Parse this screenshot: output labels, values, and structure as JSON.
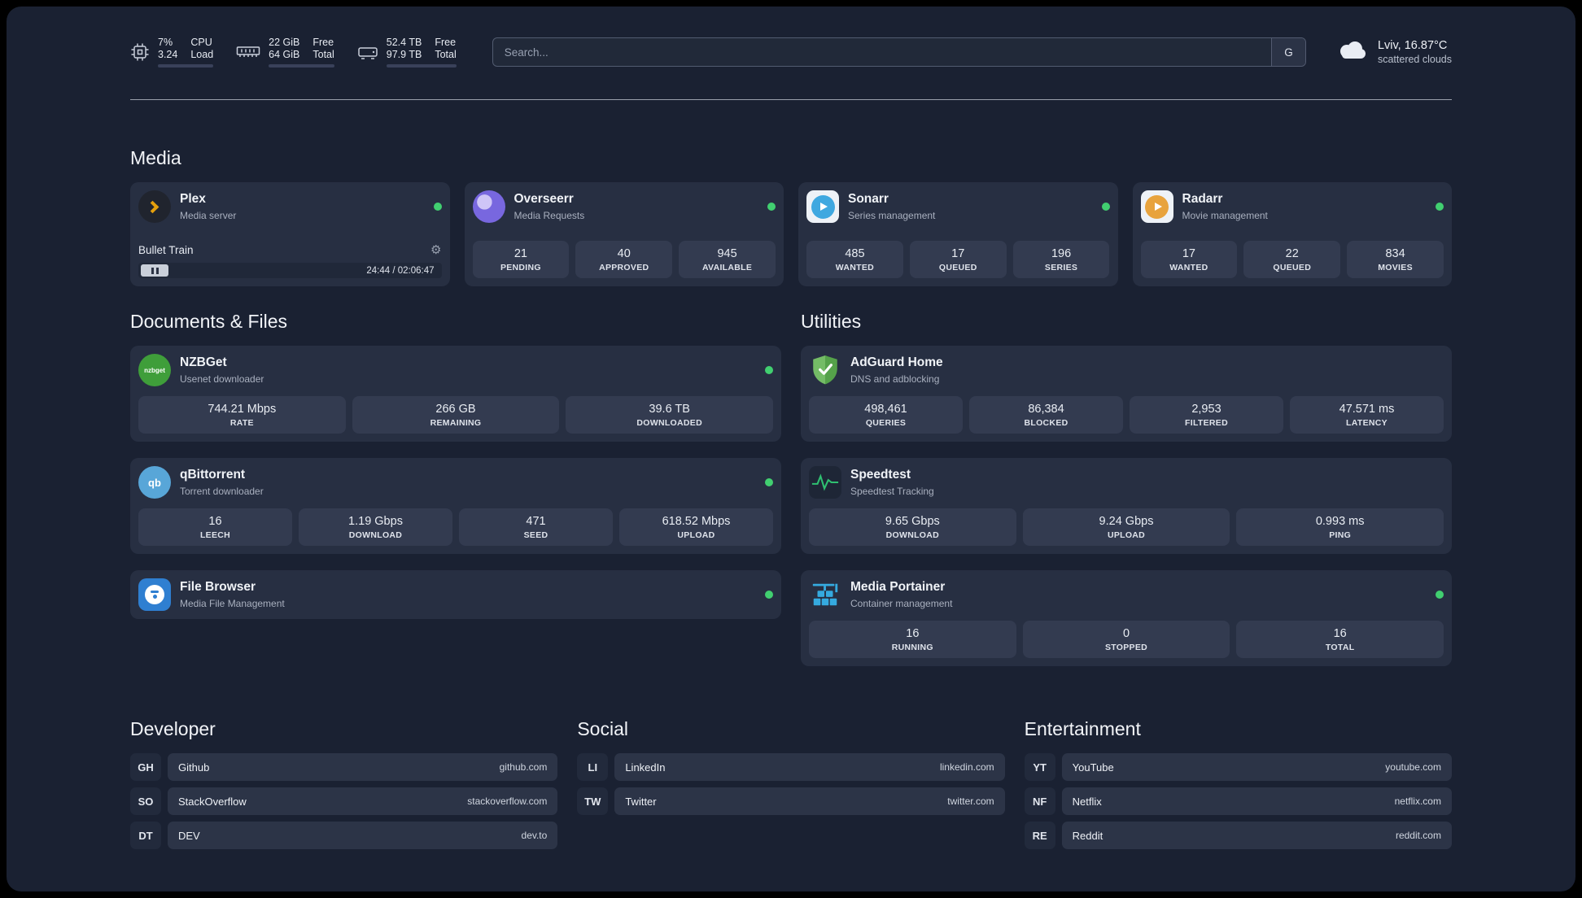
{
  "colors": {
    "background": "#1a2132",
    "card": "#272f42",
    "tile": "#333b50",
    "status_green": "#41cf70",
    "plex_amber": "#e5a00d",
    "overseerr_purple": "#7867df",
    "sonarr_blue": "#3fa8e0",
    "radarr_gold": "#e8a33d",
    "nzbget_green": "#3f9e3a",
    "qbittorrent_blue": "#58a6d8",
    "filebrowser_blue": "#2f7fd1",
    "adguard_green": "#67b279",
    "speedtest_green": "#2fbf71",
    "portainer_blue": "#35aadf"
  },
  "topbar": {
    "cpu": {
      "value1": "7%",
      "value2": "3.24",
      "label1": "CPU",
      "label2": "Load"
    },
    "memory": {
      "value1": "22 GiB",
      "value2": "64 GiB",
      "label1": "Free",
      "label2": "Total"
    },
    "disk": {
      "value1": "52.4 TB",
      "value2": "97.9 TB",
      "label1": "Free",
      "label2": "Total"
    },
    "search": {
      "placeholder": "Search...",
      "engine": "G"
    },
    "weather": {
      "location": "Lviv, 16.87°C",
      "condition": "scattered clouds"
    }
  },
  "media": {
    "title": "Media",
    "plex": {
      "name": "Plex",
      "subtitle": "Media server",
      "track": "Bullet Train",
      "time": "24:44 / 02:06:47"
    },
    "overseerr": {
      "name": "Overseerr",
      "subtitle": "Media Requests",
      "stats": [
        {
          "value": "21",
          "label": "PENDING"
        },
        {
          "value": "40",
          "label": "APPROVED"
        },
        {
          "value": "945",
          "label": "AVAILABLE"
        }
      ]
    },
    "sonarr": {
      "name": "Sonarr",
      "subtitle": "Series management",
      "stats": [
        {
          "value": "485",
          "label": "WANTED"
        },
        {
          "value": "17",
          "label": "QUEUED"
        },
        {
          "value": "196",
          "label": "SERIES"
        }
      ]
    },
    "radarr": {
      "name": "Radarr",
      "subtitle": "Movie management",
      "stats": [
        {
          "value": "17",
          "label": "WANTED"
        },
        {
          "value": "22",
          "label": "QUEUED"
        },
        {
          "value": "834",
          "label": "MOVIES"
        }
      ]
    }
  },
  "documents": {
    "title": "Documents & Files",
    "nzbget": {
      "name": "NZBGet",
      "subtitle": "Usenet downloader",
      "icon_text": "nzbget",
      "stats": [
        {
          "value": "744.21 Mbps",
          "label": "RATE"
        },
        {
          "value": "266 GB",
          "label": "REMAINING"
        },
        {
          "value": "39.6 TB",
          "label": "DOWNLOADED"
        }
      ]
    },
    "qbittorrent": {
      "name": "qBittorrent",
      "subtitle": "Torrent downloader",
      "icon_text": "qb",
      "stats": [
        {
          "value": "16",
          "label": "LEECH"
        },
        {
          "value": "1.19 Gbps",
          "label": "DOWNLOAD"
        },
        {
          "value": "471",
          "label": "SEED"
        },
        {
          "value": "618.52 Mbps",
          "label": "UPLOAD"
        }
      ]
    },
    "filebrowser": {
      "name": "File Browser",
      "subtitle": "Media File Management"
    }
  },
  "utilities": {
    "title": "Utilities",
    "adguard": {
      "name": "AdGuard Home",
      "subtitle": "DNS and adblocking",
      "stats": [
        {
          "value": "498,461",
          "label": "QUERIES"
        },
        {
          "value": "86,384",
          "label": "BLOCKED"
        },
        {
          "value": "2,953",
          "label": "FILTERED"
        },
        {
          "value": "47.571 ms",
          "label": "LATENCY"
        }
      ]
    },
    "speedtest": {
      "name": "Speedtest",
      "subtitle": "Speedtest Tracking",
      "stats": [
        {
          "value": "9.65 Gbps",
          "label": "DOWNLOAD"
        },
        {
          "value": "9.24 Gbps",
          "label": "UPLOAD"
        },
        {
          "value": "0.993 ms",
          "label": "PING"
        }
      ]
    },
    "portainer": {
      "name": "Media Portainer",
      "subtitle": "Container management",
      "stats": [
        {
          "value": "16",
          "label": "RUNNING"
        },
        {
          "value": "0",
          "label": "STOPPED"
        },
        {
          "value": "16",
          "label": "TOTAL"
        }
      ]
    }
  },
  "bookmarks": {
    "developer": {
      "title": "Developer",
      "items": [
        {
          "abbr": "GH",
          "name": "Github",
          "url": "github.com"
        },
        {
          "abbr": "SO",
          "name": "StackOverflow",
          "url": "stackoverflow.com"
        },
        {
          "abbr": "DT",
          "name": "DEV",
          "url": "dev.to"
        }
      ]
    },
    "social": {
      "title": "Social",
      "items": [
        {
          "abbr": "LI",
          "name": "LinkedIn",
          "url": "linkedin.com"
        },
        {
          "abbr": "TW",
          "name": "Twitter",
          "url": "twitter.com"
        }
      ]
    },
    "entertainment": {
      "title": "Entertainment",
      "items": [
        {
          "abbr": "YT",
          "name": "YouTube",
          "url": "youtube.com"
        },
        {
          "abbr": "NF",
          "name": "Netflix",
          "url": "netflix.com"
        },
        {
          "abbr": "RE",
          "name": "Reddit",
          "url": "reddit.com"
        }
      ]
    }
  }
}
